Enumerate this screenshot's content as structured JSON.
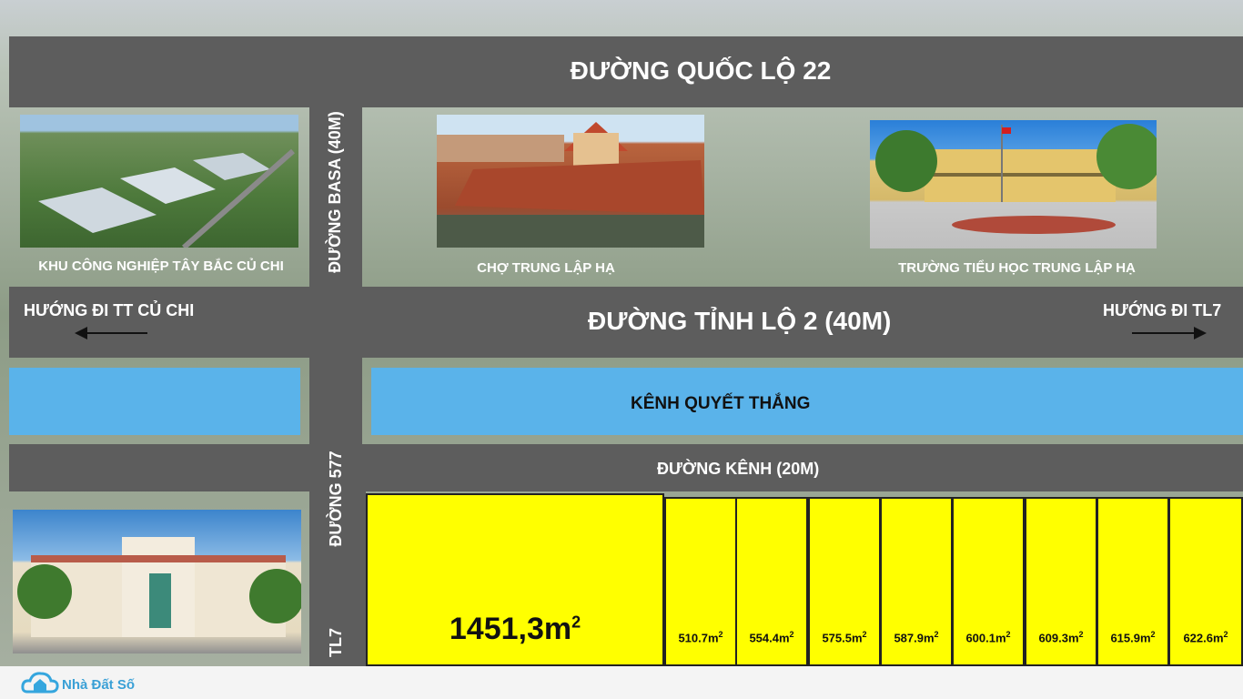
{
  "roads": {
    "ql22": "ĐƯỜNG QUỐC LỘ 22",
    "basa": "ĐƯỜNG BASA (40M)",
    "tl2": "ĐƯỜNG TỈNH LỘ 2 (40M)",
    "kenh_road": "ĐƯỜNG KÊNH (20M)",
    "road577": "ĐƯỜNG 577",
    "tl7": "TL7"
  },
  "directions": {
    "left": "HƯỚNG ĐI TT CỦ CHI",
    "right": "HƯỚNG ĐI TL7"
  },
  "canal": "KÊNH QUYẾT THẮNG",
  "places": {
    "industrial": "KHU CÔNG NGHIỆP TÂY BẮC CỦ CHI",
    "market": "CHỢ TRUNG LẬP HẠ",
    "school": "TRƯỜNG TIỂU HỌC TRUNG LẬP HẠ"
  },
  "lots": {
    "big_value": "1451,3m",
    "big_sup": "2",
    "items": [
      {
        "value": "510.7m",
        "sup": "2"
      },
      {
        "value": "554.4m",
        "sup": "2"
      },
      {
        "value": "575.5m",
        "sup": "2"
      },
      {
        "value": "587.9m",
        "sup": "2"
      },
      {
        "value": "600.1m",
        "sup": "2"
      },
      {
        "value": "609.3m",
        "sup": "2"
      },
      {
        "value": "615.9m",
        "sup": "2"
      },
      {
        "value": "622.6m",
        "sup": "2"
      }
    ]
  },
  "brand": {
    "name": "Nhà Đất Số",
    "icon": "house-cloud-icon"
  },
  "colors": {
    "road": "#5d5d5d",
    "canal": "#5ab3ea",
    "lot": "#ffff00"
  }
}
